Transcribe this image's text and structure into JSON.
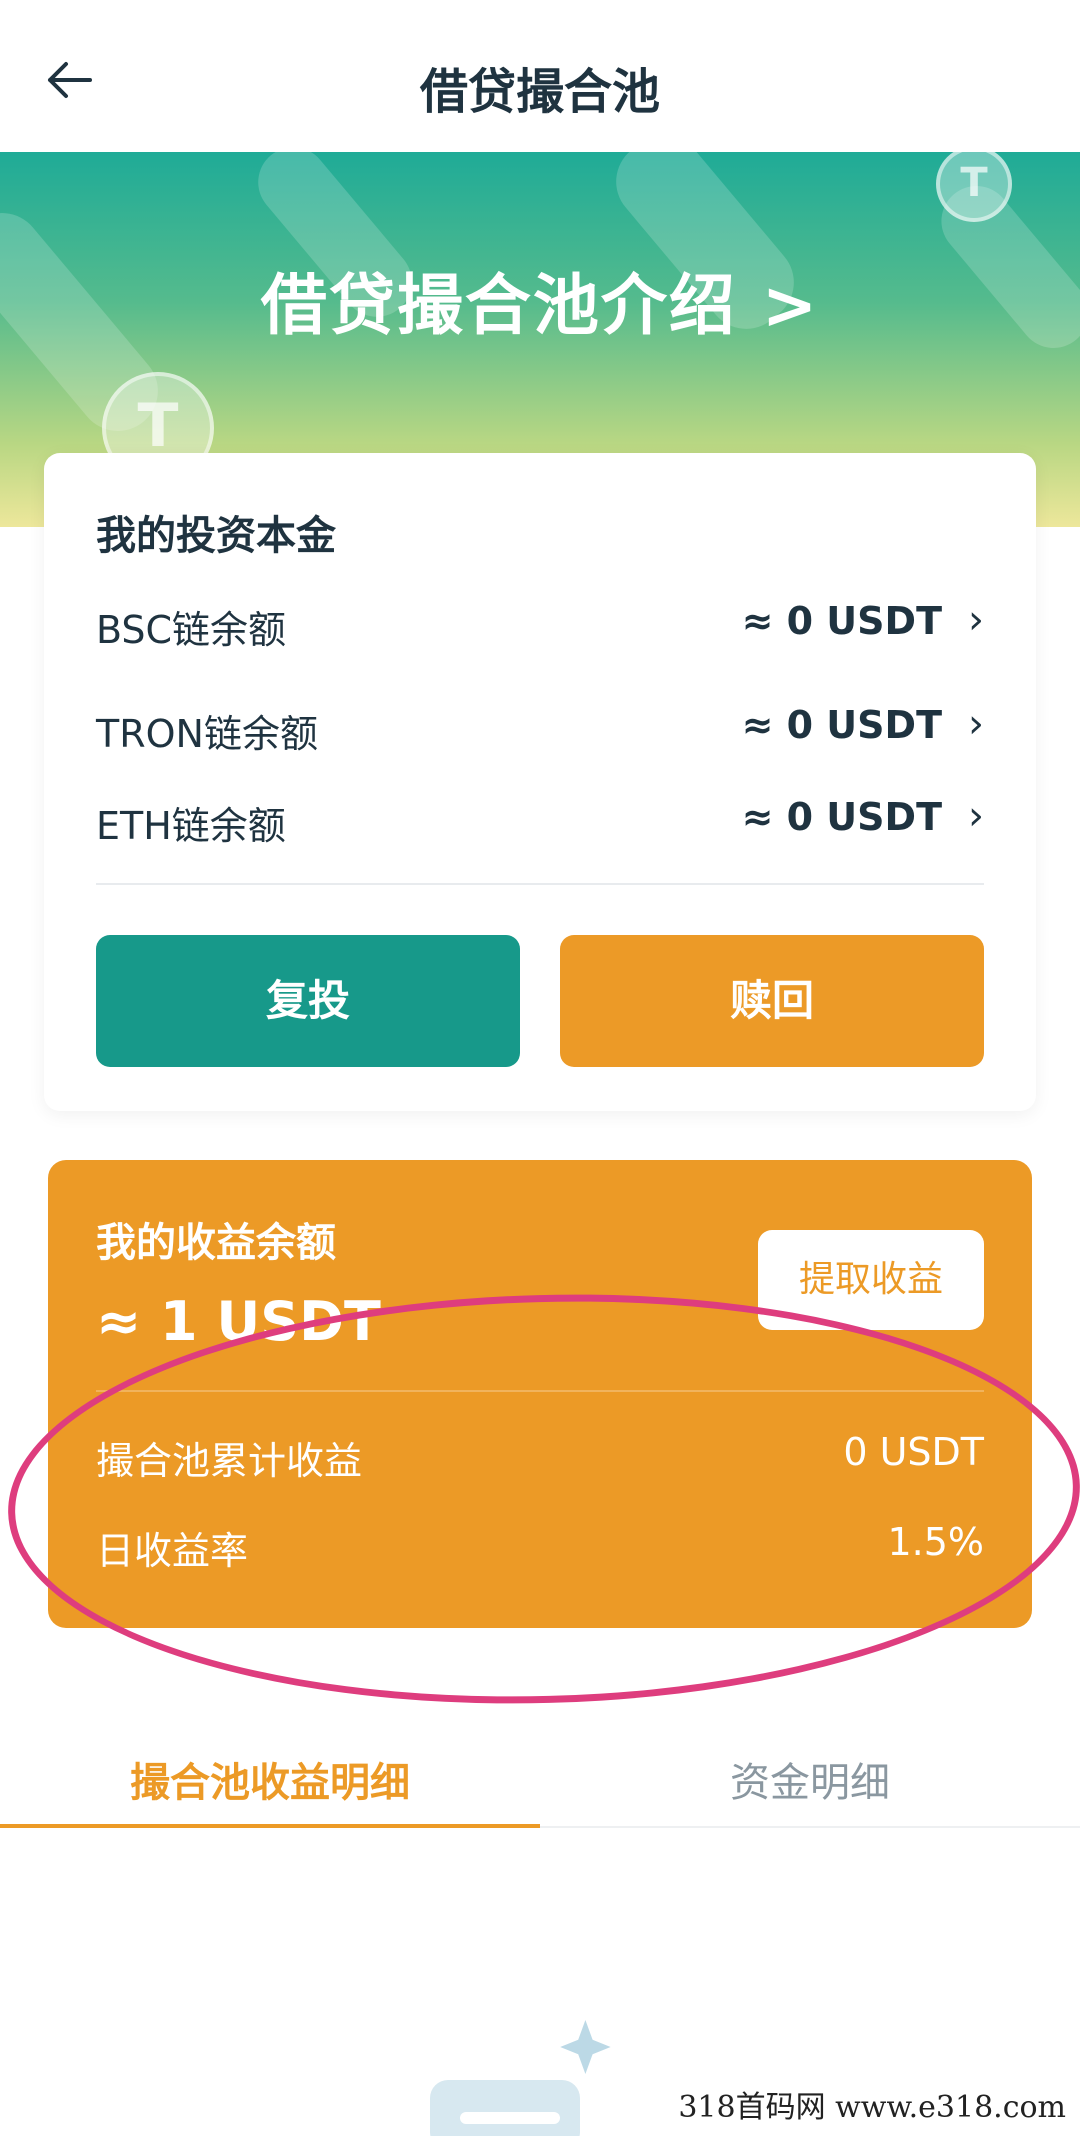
{
  "header": {
    "title": "借贷撮合池",
    "back_icon": "arrow-left-icon"
  },
  "banner": {
    "title": "借贷撮合池介绍 >"
  },
  "principal": {
    "title": "我的投资本金",
    "balances": [
      {
        "label": "BSC链余额",
        "value": "≈ 0 USDT"
      },
      {
        "label": "TRON链余额",
        "value": "≈ 0 USDT"
      },
      {
        "label": "ETH链余额",
        "value": "≈ 0 USDT"
      }
    ],
    "reinvest_label": "复投",
    "redeem_label": "赎回"
  },
  "earnings": {
    "title": "我的收益余额",
    "amount": "≈ 1 USDT",
    "withdraw_label": "提取收益",
    "rows": [
      {
        "label": "撮合池累计收益",
        "value": "0 USDT"
      },
      {
        "label": "日收益率",
        "value": "1.5%"
      }
    ]
  },
  "tabs": [
    {
      "label": "撮合池收益明细",
      "active": true
    },
    {
      "label": "资金明细",
      "active": false
    }
  ],
  "watermark": "318首码网  www.e318.com",
  "colors": {
    "teal": "#17998a",
    "orange": "#ec9a26",
    "highlight": "#de3d7e"
  }
}
